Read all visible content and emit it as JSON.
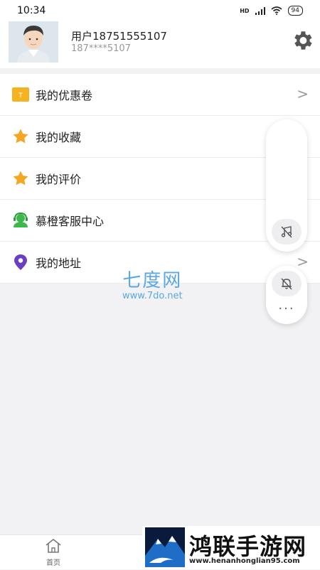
{
  "status": {
    "time": "10:34",
    "hd": "HD",
    "battery": "94"
  },
  "profile": {
    "name": "用户18751555107",
    "phone": "187****5107"
  },
  "menu": [
    {
      "label": "我的优惠卷",
      "icon": "coupon-icon",
      "chevron": ">"
    },
    {
      "label": "我的收藏",
      "icon": "star-icon"
    },
    {
      "label": "我的评价",
      "icon": "star-icon"
    },
    {
      "label": "慕橙客服中心",
      "icon": "customer-service-icon"
    },
    {
      "label": "我的地址",
      "icon": "location-pin-icon",
      "chevron": ">"
    }
  ],
  "watermark": {
    "title": "七度网",
    "url": "www.7do.net"
  },
  "float": {
    "more": "···"
  },
  "tabbar": {
    "home": "首页"
  },
  "banner": {
    "name": "鸿联手游网",
    "url": "www.henanhonglian95.com"
  },
  "colors": {
    "coupon": "#f5b321",
    "star": "#f5a623",
    "service": "#3cb94a",
    "location": "#6b3fbf",
    "watermark": "#5aa7e6"
  }
}
